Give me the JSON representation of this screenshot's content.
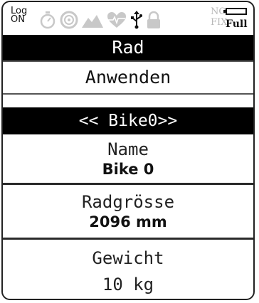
{
  "status": {
    "log_line1": "Log",
    "log_line2": "ON",
    "icons": [
      "stopwatch-icon",
      "wheel-icon",
      "elevation-icon",
      "heart-rate-icon",
      "usb-icon",
      "lock-icon"
    ],
    "gps_line1": "NO",
    "gps_line2": "FIX",
    "battery_label": "Full"
  },
  "screen": {
    "title": "Rad",
    "apply_label": "Anwenden",
    "bike_selector": "<< Bike0>>",
    "fields": [
      {
        "label": "Name",
        "value": "Bike 0"
      },
      {
        "label": "Radgrösse",
        "value": "2096 mm"
      },
      {
        "label": "Gewicht",
        "value": "10 kg"
      }
    ]
  },
  "colors": {
    "highlight_bg": "#000000",
    "highlight_fg": "#ffffff",
    "inactive_icon": "#c8c8c8"
  }
}
